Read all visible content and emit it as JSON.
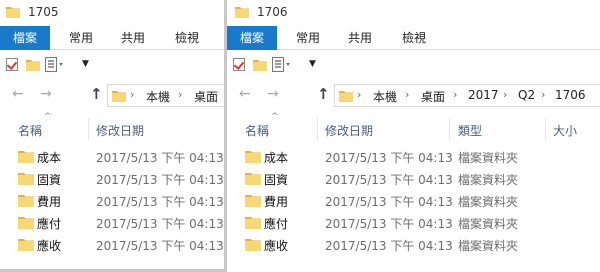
{
  "colors": {
    "ribbon_file_tab": "#1979ca",
    "folder_yellow": "#f8d775",
    "folder_dark": "#e0b445",
    "column_header_text": "#4c607a",
    "date_text": "#6d6d6d"
  },
  "icons": {
    "folder": "folder-icon",
    "properties": "properties-icon",
    "back": "back-arrow-icon",
    "forward": "forward-arrow-icon",
    "up": "up-arrow-icon"
  },
  "left": {
    "title": "1705",
    "ribbon": {
      "file": "檔案",
      "home": "常用",
      "share": "共用",
      "view": "檢視"
    },
    "nav": {
      "back": "←",
      "forward": "→",
      "up": "↑"
    },
    "breadcrumb": [
      "本機",
      "桌面"
    ],
    "columns": {
      "name": "名稱",
      "date": "修改日期"
    },
    "items": [
      {
        "name": "成本",
        "date": "2017/5/13 下午 04:13"
      },
      {
        "name": "固資",
        "date": "2017/5/13 下午 04:13"
      },
      {
        "name": "費用",
        "date": "2017/5/13 下午 04:13"
      },
      {
        "name": "應付",
        "date": "2017/5/13 下午 04:13"
      },
      {
        "name": "應收",
        "date": "2017/5/13 下午 04:13"
      }
    ]
  },
  "right": {
    "title": "1706",
    "ribbon": {
      "file": "檔案",
      "home": "常用",
      "share": "共用",
      "view": "檢視"
    },
    "nav": {
      "back": "←",
      "forward": "→",
      "up": "↑"
    },
    "breadcrumb": [
      "本機",
      "桌面",
      "2017",
      "Q2",
      "1706"
    ],
    "columns": {
      "name": "名稱",
      "date": "修改日期",
      "type": "類型",
      "size": "大小"
    },
    "items": [
      {
        "name": "成本",
        "date": "2017/5/13 下午 04:13",
        "type": "檔案資料夾"
      },
      {
        "name": "固資",
        "date": "2017/5/13 下午 04:13",
        "type": "檔案資料夾"
      },
      {
        "name": "費用",
        "date": "2017/5/13 下午 04:13",
        "type": "檔案資料夾"
      },
      {
        "name": "應付",
        "date": "2017/5/13 下午 04:13",
        "type": "檔案資料夾"
      },
      {
        "name": "應收",
        "date": "2017/5/13 下午 04:13",
        "type": "檔案資料夾"
      }
    ]
  }
}
